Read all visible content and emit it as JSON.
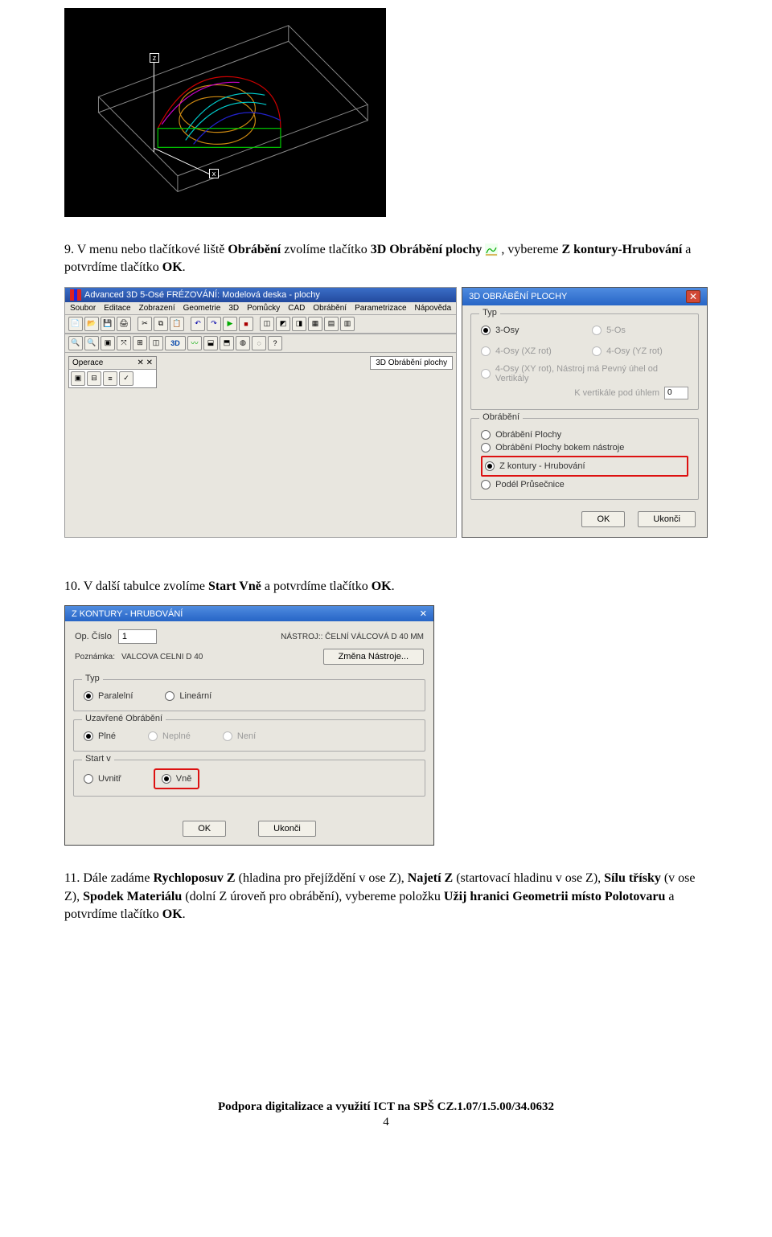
{
  "cad": {
    "axis_x": "x",
    "axis_z": "z"
  },
  "para1": {
    "num": "9. ",
    "p1": "V menu nebo tlačítkové liště ",
    "b1": "Obrábění",
    "p2": " zvolíme tlačítko ",
    "b2": "3D Obrábění plochy",
    "p3": " , vybereme ",
    "b3": "Z kontury-Hrubování",
    "p4": " a potvrdíme tlačítko ",
    "b4": "OK",
    "p5": "."
  },
  "app": {
    "title": "Advanced 3D 5-Osé FRÉZOVÁNÍ: Modelová deska - plochy",
    "menus": [
      "Soubor",
      "Editace",
      "Zobrazení",
      "Geometrie",
      "3D",
      "Pomůcky",
      "CAD",
      "Obrábění",
      "Parametrizace",
      "Nápověda"
    ],
    "tb_3d_label": "3D",
    "panel": {
      "title": "Operace",
      "pin": "✕ ✕"
    },
    "big_tab": "3D Obrábění plochy"
  },
  "dlg1": {
    "title": "3D OBRÁBĚNÍ PLOCHY",
    "grp_type": "Typ",
    "opts_top": {
      "r1": "3-Osy",
      "r2": "5-Os",
      "r3": "4-Osy (XZ rot)",
      "r4": "4-Osy (YZ rot)",
      "r5": "4-Osy (XY rot), Nástroj má Pevný úhel od Vertikály",
      "r5_sub": "K vertikále pod úhlem",
      "r5_val": "0"
    },
    "grp_mach": "Obrábění",
    "radios2": {
      "a": "Obrábění Plochy",
      "b": "Obrábění Plochy bokem nástroje",
      "c": "Z kontury - Hrubování",
      "d": "Podél Průsečnice"
    },
    "ok": "OK",
    "cancel": "Ukonči"
  },
  "para2": {
    "num": "10. ",
    "p1": "V další tabulce zvolíme ",
    "b1": "Start Vně",
    "p2": " a potvrdíme tlačítko  ",
    "b2": "OK",
    "p3": "."
  },
  "dlg2": {
    "title": "Z KONTURY - HRUBOVÁNÍ",
    "op_num_lbl": "Op. Číslo",
    "op_num_val": "1",
    "tool_lbl": "NÁSTROJ:: ČELNÍ VÁLCOVÁ D  40 MM",
    "note_lbl": "Poznámka:",
    "note_val": "VALCOVA CELNI D 40",
    "change_btn": "Změna Nástroje...",
    "grp_type": "Typ",
    "type": {
      "a": "Paralelní",
      "b": "Lineární"
    },
    "grp_closed": "Uzavřené Obrábění",
    "closed": {
      "a": "Plné",
      "b": "Neplné",
      "c": "Není"
    },
    "grp_start": "Start v",
    "start": {
      "a": "Uvnitř",
      "b": "Vně"
    },
    "ok": "OK",
    "cancel": "Ukonči"
  },
  "para3": {
    "num": "11. ",
    "p1": "Dále zadáme ",
    "b1": "Rychloposuv Z",
    "p2": " (hladina pro přejíždění v ose Z), ",
    "b2": "Najetí Z",
    "p3": " (startovací hladinu v ose Z), ",
    "b3": "Sílu třísky",
    "p4": " (v ose Z), ",
    "b4": "Spodek Materiálu",
    "p5": " (dolní Z úroveň pro obrábění), vybereme položku ",
    "b5": "Užij hranici Geometrii místo Polotovaru",
    "p6": " a potvrdíme tlačítko ",
    "b6": "OK",
    "p7": "."
  },
  "footer": {
    "line": "Podpora digitalizace a využití ICT na SPŠ  CZ.1.07/1.5.00/34.0632",
    "page": "4"
  }
}
